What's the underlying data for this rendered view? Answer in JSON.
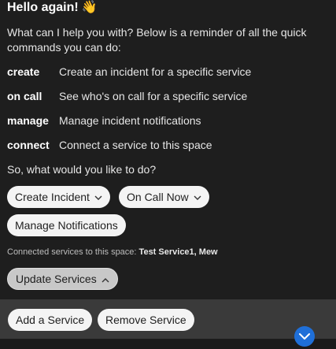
{
  "message": {
    "title": "Hello again!",
    "emoji": "👋",
    "intro": "What can I help you with? Below is a reminder of all the quick commands you can do:",
    "commands": [
      {
        "key": "create",
        "desc": "Create an incident for a specific service"
      },
      {
        "key": "on call",
        "desc": "See who's on call for a specific service"
      },
      {
        "key": "manage",
        "desc": "Manage incident notifications"
      },
      {
        "key": "connect",
        "desc": "Connect a service to this space"
      }
    ],
    "question": "So, what would you like to do?"
  },
  "actions": {
    "create_incident": "Create Incident",
    "on_call_now": "On Call Now",
    "manage_notifications": "Manage Notifications",
    "update_services": "Update Services"
  },
  "connected": {
    "label": "Connected services to this space:",
    "services": "Test Service1, Mew"
  },
  "bottom": {
    "add_service": "Add a Service",
    "remove_service": "Remove Service"
  },
  "icons": {
    "chevron_down": "chevron-down-icon",
    "chevron_up": "chevron-up-icon",
    "scroll_down": "scroll-down-icon"
  },
  "colors": {
    "background": "#1e1e1e",
    "pill": "#f4f4f4",
    "accent": "#1f6fd8"
  }
}
